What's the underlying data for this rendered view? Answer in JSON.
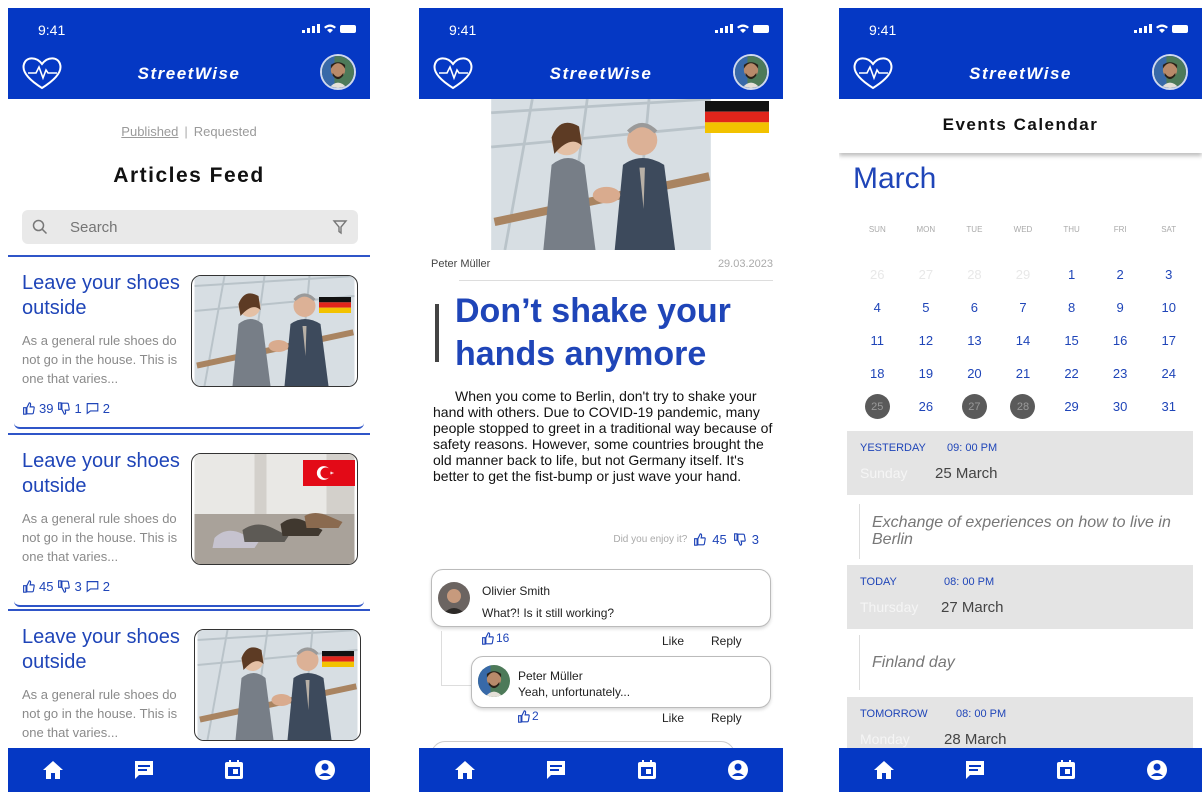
{
  "status": {
    "time": "9:41"
  },
  "app": {
    "brand": "StreetWise"
  },
  "feed": {
    "tab_published": "Published",
    "tab_separator": "|",
    "tab_requested": "Requested",
    "title": "Articles Feed",
    "search_placeholder": "Search",
    "cards": [
      {
        "title": "Leave your shoes outside",
        "excerpt": "As a general rule shoes do not go in the house. This is one that varies...",
        "likes": "39",
        "dislikes": "1",
        "comments": "2",
        "flag": "germany"
      },
      {
        "title": "Leave your shoes outside",
        "excerpt": "As a general rule shoes do not go in the house. This is one that varies...",
        "likes": "45",
        "dislikes": "3",
        "comments": "2",
        "flag": "turkey"
      },
      {
        "title": "Leave your shoes outside",
        "excerpt": "As a general rule shoes do not go in the house. This is one that varies...",
        "flag": "germany"
      }
    ]
  },
  "article": {
    "author": "Peter Müller",
    "date": "29.03.2023",
    "headline": "Don’t shake your hands anymore",
    "body": "When you come to Berlin, don't try to shake your hand with others. Due to COVID-19 pandemic, many people stopped to greet in a traditional way because of safety reasons. However, some countries brought the old manner back to life, but not Germany itself. It's better to get the fist-bump or just wave your hand.",
    "enjoy_prompt": "Did you enjoy it?",
    "likes": "45",
    "dislikes": "3",
    "comments": [
      {
        "name": "Olivier Smith",
        "text": "What?! Is it still working?",
        "likes": "16",
        "like_label": "Like",
        "reply_label": "Reply"
      },
      {
        "name": "Peter Müller",
        "text": "Yeah, unfortunately...",
        "likes": "2",
        "like_label": "Like",
        "reply_label": "Reply"
      }
    ]
  },
  "calendar": {
    "header": "Events Calendar",
    "month": "March",
    "weekdays": [
      "SUN",
      "MON",
      "TUE",
      "WED",
      "THU",
      "FRI",
      "SAT"
    ],
    "days": [
      "26",
      "27",
      "28",
      "29",
      "1",
      "2",
      "3",
      "4",
      "5",
      "6",
      "7",
      "8",
      "9",
      "10",
      "11",
      "12",
      "13",
      "14",
      "15",
      "16",
      "17",
      "18",
      "19",
      "20",
      "21",
      "22",
      "23",
      "24",
      "25",
      "26",
      "27",
      "28",
      "29",
      "30",
      "31"
    ],
    "muted_days": [
      0,
      1,
      2,
      3
    ],
    "marked_days": [
      28,
      30,
      31
    ],
    "events": [
      {
        "relative": "YESTERDAY",
        "time": "09: 00 PM",
        "weekday": "Sunday",
        "date": "25 March",
        "title": "Exchange of experiences on how to live in Berlin"
      },
      {
        "relative": "TODAY",
        "time": "08: 00 PM",
        "weekday": "Thursday",
        "date": "27 March",
        "title": "Finland day"
      },
      {
        "relative": "TOMORROW",
        "time": "08: 00 PM",
        "weekday": "Monday",
        "date": "28 March"
      }
    ]
  },
  "colors": {
    "primary": "#0538c4",
    "link": "#1f45b8",
    "event_bg": "#e4e4e4",
    "marked_day": "#5a5a5a"
  },
  "nav": [
    "home-icon",
    "article-icon",
    "calendar-icon",
    "profile-icon"
  ]
}
